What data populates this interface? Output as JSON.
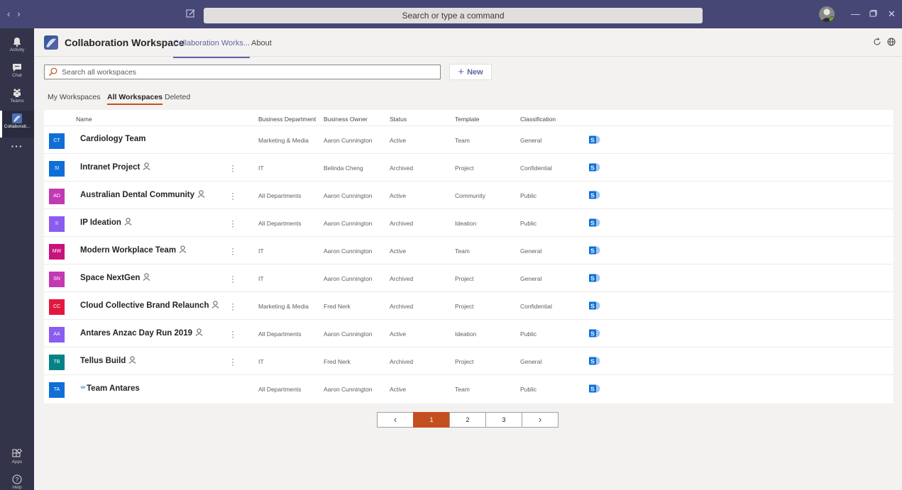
{
  "titlebar": {
    "search_placeholder": "Search or type a command",
    "back": "‹",
    "forward": "›"
  },
  "rail": {
    "items": [
      {
        "label": "Activity",
        "icon": "bell-icon"
      },
      {
        "label": "Chat",
        "icon": "chat-icon"
      },
      {
        "label": "Teams",
        "icon": "teams-icon"
      },
      {
        "label": "Collaborati...",
        "icon": "collaboration-app-icon"
      },
      {
        "label": "Apps",
        "icon": "apps-icon"
      },
      {
        "label": "Help",
        "icon": "help-icon"
      }
    ]
  },
  "header": {
    "app_title": "Collaboration Workspace",
    "tabs": [
      {
        "label": "Collaboration Works...",
        "active": true
      },
      {
        "label": "About",
        "active": false
      }
    ]
  },
  "search": {
    "placeholder": "Search all workspaces"
  },
  "new_button": "New",
  "subtabs": [
    {
      "label": "My Workspaces",
      "active": false
    },
    {
      "label": "All Workspaces",
      "active": true
    },
    {
      "label": "Deleted",
      "active": false
    }
  ],
  "table": {
    "columns": [
      "Name",
      "Business Department",
      "Business Owner",
      "Status",
      "Template",
      "Classification"
    ],
    "rows": [
      {
        "initials": "CT",
        "color": "#0f6fd6",
        "name": "Cardiology Team",
        "guest": false,
        "menu": false,
        "activity": false,
        "dept": "Marketing & Media",
        "owner": "Aaron Cunnington",
        "status": "Active",
        "template": "Team",
        "classification": "General"
      },
      {
        "initials": "SI",
        "color": "#0f6fd6",
        "name": "Intranet Project",
        "guest": true,
        "menu": true,
        "activity": false,
        "dept": "IT",
        "owner": "Belinda Cheng",
        "status": "Archived",
        "template": "Project",
        "classification": "Confidential"
      },
      {
        "initials": "AD",
        "color": "#c239b3",
        "name": "Australian Dental Community",
        "guest": true,
        "menu": true,
        "activity": false,
        "dept": "All Departments",
        "owner": "Aaron Cunnington",
        "status": "Active",
        "template": "Community",
        "classification": "Public"
      },
      {
        "initials": "II",
        "color": "#8a5cf0",
        "name": "IP Ideation",
        "guest": true,
        "menu": true,
        "activity": false,
        "dept": "All Departments",
        "owner": "Aaron Cunnington",
        "status": "Archived",
        "template": "Ideation",
        "classification": "Public"
      },
      {
        "initials": "MW",
        "color": "#c8137c",
        "name": "Modern Workplace Team",
        "guest": true,
        "menu": true,
        "activity": false,
        "dept": "IT",
        "owner": "Aaron Cunnington",
        "status": "Active",
        "template": "Team",
        "classification": "General"
      },
      {
        "initials": "SN",
        "color": "#c239b3",
        "name": "Space NextGen",
        "guest": true,
        "menu": true,
        "activity": false,
        "dept": "IT",
        "owner": "Aaron Cunnington",
        "status": "Archived",
        "template": "Project",
        "classification": "General"
      },
      {
        "initials": "CC",
        "color": "#e3173e",
        "name": "Cloud Collective Brand Relaunch",
        "guest": true,
        "menu": true,
        "activity": false,
        "dept": "Marketing & Media",
        "owner": "Fred Nerk",
        "status": "Archived",
        "template": "Project",
        "classification": "Confidential"
      },
      {
        "initials": "AA",
        "color": "#8a5cf0",
        "name": "Antares Anzac Day Run 2019",
        "guest": true,
        "menu": true,
        "activity": false,
        "dept": "All Departments",
        "owner": "Aaron Cunnington",
        "status": "Active",
        "template": "Ideation",
        "classification": "Public"
      },
      {
        "initials": "TB",
        "color": "#038387",
        "name": "Tellus Build",
        "guest": true,
        "menu": true,
        "activity": false,
        "dept": "IT",
        "owner": "Fred Nerk",
        "status": "Archived",
        "template": "Project",
        "classification": "General"
      },
      {
        "initials": "TA",
        "color": "#0f6fd6",
        "name": "Team Antares",
        "guest": false,
        "menu": false,
        "activity": true,
        "dept": "All Departments",
        "owner": "Aaron Cunnington",
        "status": "Active",
        "template": "Team",
        "classification": "Public"
      }
    ]
  },
  "pagination": {
    "prev": "‹",
    "pages": [
      "1",
      "2",
      "3"
    ],
    "current": "1",
    "next": "›"
  },
  "colors": {
    "brand": "#6264a7",
    "titlebar": "#464775",
    "rail": "#33344a",
    "accent": "#c4501f",
    "sharepoint": "#0f6fd6"
  }
}
